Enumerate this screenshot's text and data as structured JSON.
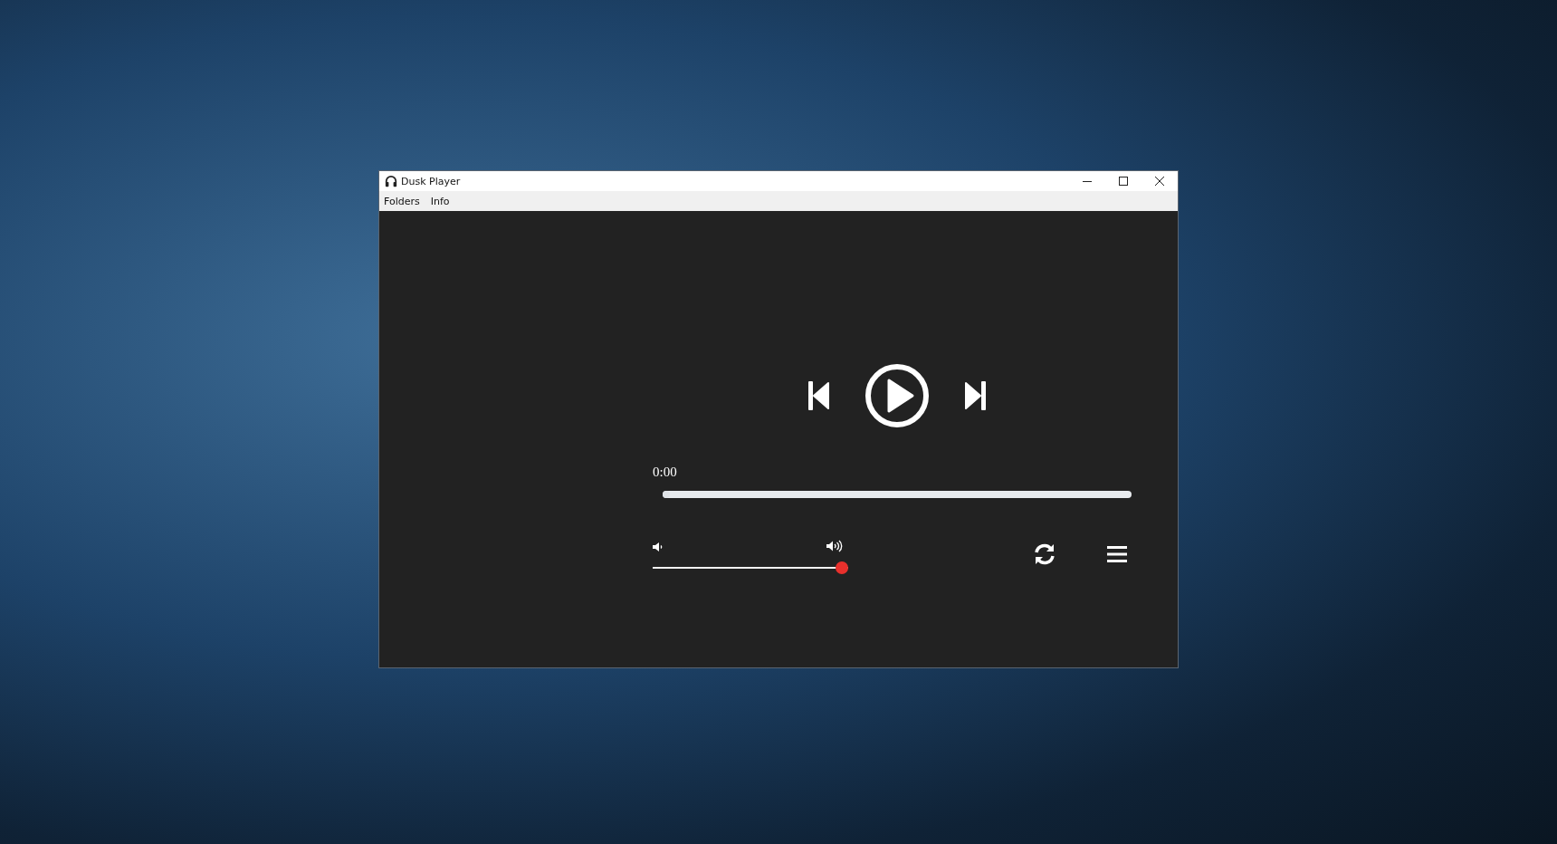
{
  "window": {
    "title": "Dusk Player"
  },
  "menu": [
    {
      "label": "Folders"
    },
    {
      "label": "Info"
    }
  ],
  "player": {
    "elapsed": "0:00",
    "progress": {
      "level": 0
    },
    "volume": {
      "level": 1
    }
  }
}
